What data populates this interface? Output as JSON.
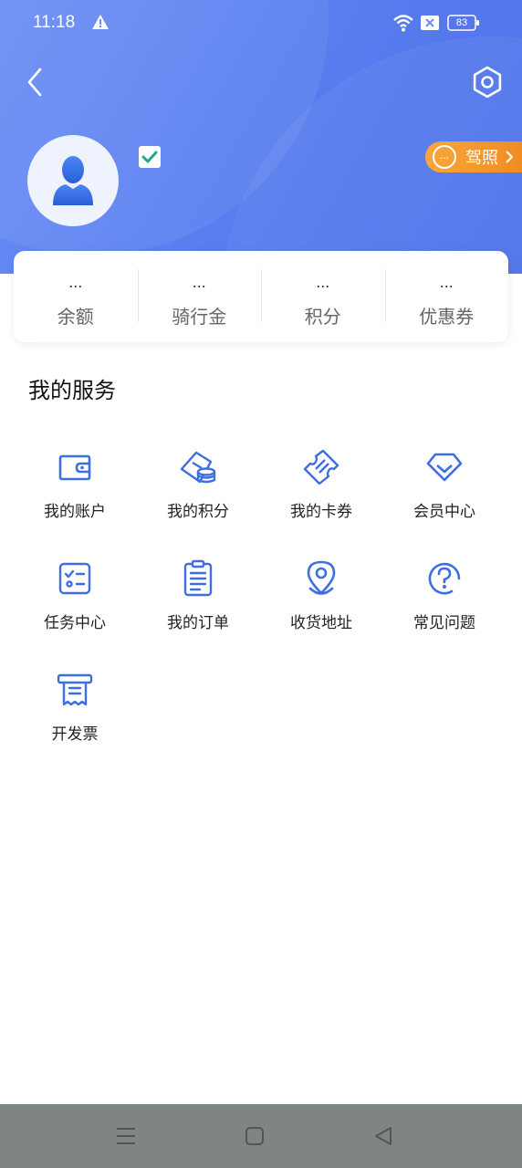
{
  "status_bar": {
    "time": "11:18",
    "battery": "83",
    "icons": [
      "warning-icon",
      "wifi-icon",
      "sim-off-icon",
      "battery-icon"
    ]
  },
  "header": {
    "gradient_colors": [
      "#6d8ff6",
      "#4d70e8"
    ]
  },
  "profile": {
    "license_dot": "...",
    "license_label": "驾照"
  },
  "stats": [
    {
      "value": "...",
      "label": "余额"
    },
    {
      "value": "...",
      "label": "骑行金"
    },
    {
      "value": "...",
      "label": "积分"
    },
    {
      "value": "...",
      "label": "优惠券"
    }
  ],
  "services": {
    "title": "我的服务",
    "items": [
      {
        "label": "我的账户",
        "icon": "wallet-icon"
      },
      {
        "label": "我的积分",
        "icon": "points-coins-icon"
      },
      {
        "label": "我的卡券",
        "icon": "ticket-icon"
      },
      {
        "label": "会员中心",
        "icon": "diamond-icon"
      },
      {
        "label": "任务中心",
        "icon": "task-list-icon"
      },
      {
        "label": "我的订单",
        "icon": "clipboard-icon"
      },
      {
        "label": "收货地址",
        "icon": "location-pin-icon"
      },
      {
        "label": "常见问题",
        "icon": "question-icon"
      },
      {
        "label": "开发票",
        "icon": "invoice-icon"
      }
    ]
  },
  "colors": {
    "accent": "#3d6fe0",
    "badge": "#f08a22",
    "check": "#1fa88a",
    "system_nav": "#7f8583"
  }
}
